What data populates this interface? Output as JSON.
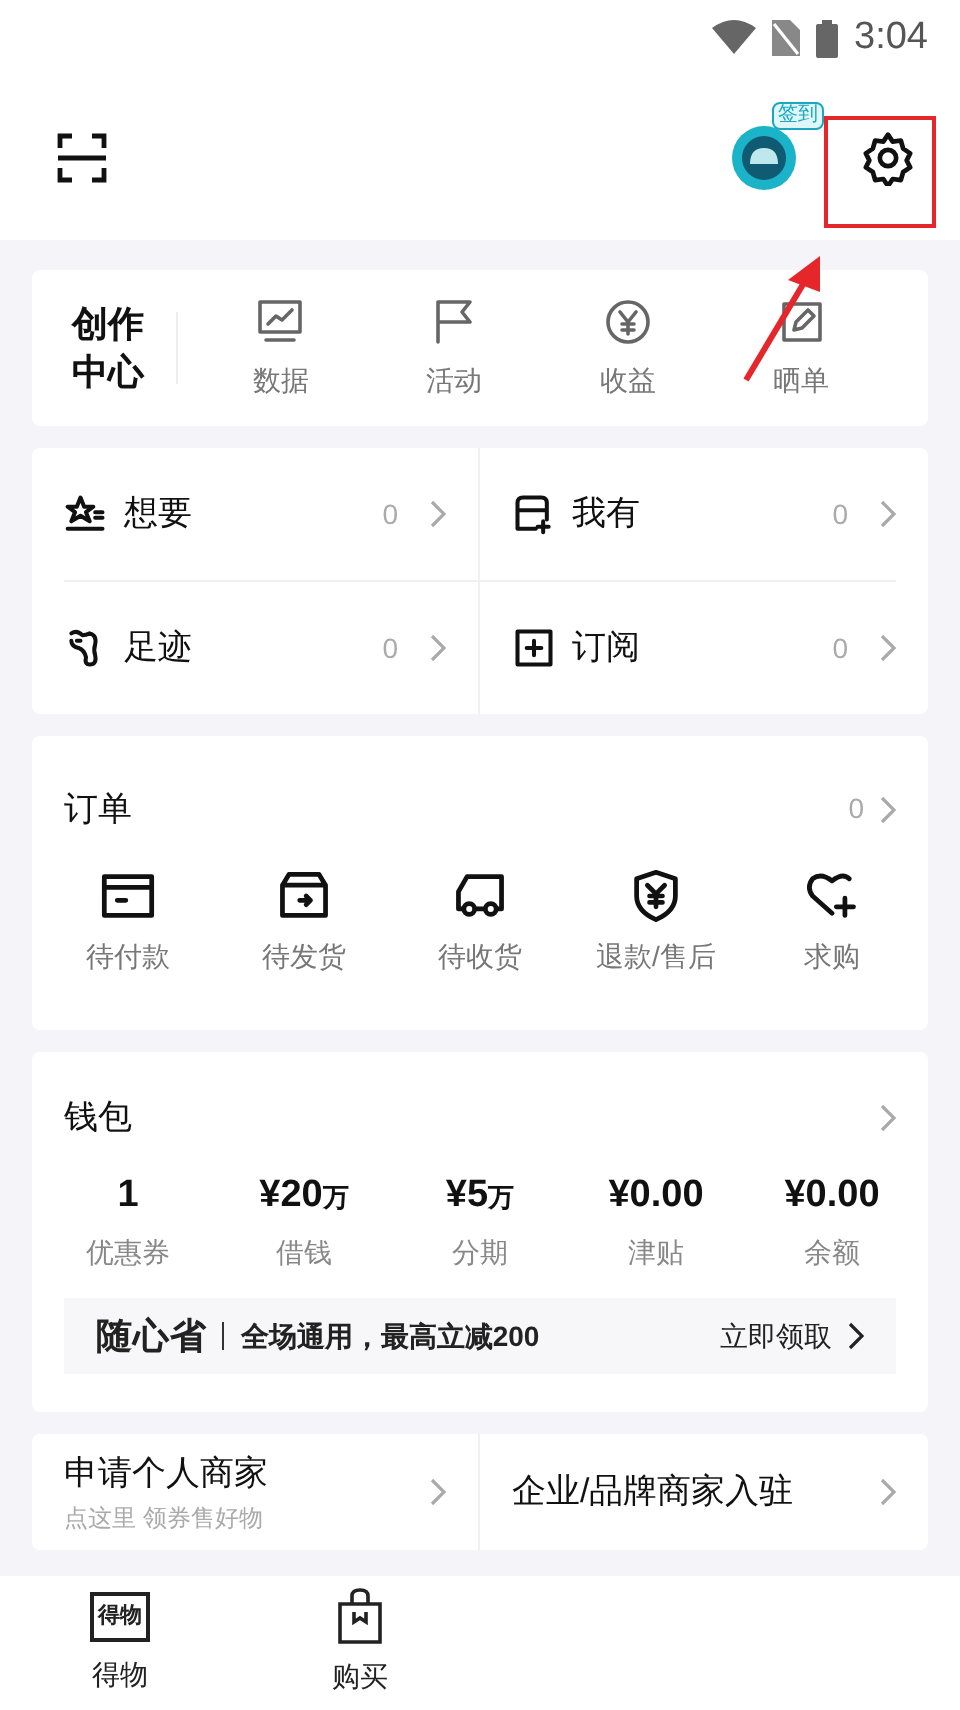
{
  "status_bar": {
    "time": "3:04"
  },
  "header": {
    "checkin_badge": "签到"
  },
  "creator_center": {
    "title": "创作中心",
    "items": [
      {
        "kind": "chart",
        "label": "数据"
      },
      {
        "kind": "flag",
        "label": "活动"
      },
      {
        "kind": "coin",
        "label": "收益"
      },
      {
        "kind": "edit",
        "label": "晒单"
      }
    ]
  },
  "collections": [
    {
      "kind": "wish",
      "label": "想要",
      "count": "0"
    },
    {
      "kind": "own",
      "label": "我有",
      "count": "0"
    },
    {
      "kind": "foot",
      "label": "足迹",
      "count": "0"
    },
    {
      "kind": "sub",
      "label": "订阅",
      "count": "0"
    }
  ],
  "orders": {
    "title": "订单",
    "count": "0",
    "items": [
      {
        "kind": "card",
        "label": "待付款"
      },
      {
        "kind": "box",
        "label": "待发货"
      },
      {
        "kind": "truck",
        "label": "待收货"
      },
      {
        "kind": "shield",
        "label": "退款/售后"
      },
      {
        "kind": "heart",
        "label": "求购"
      }
    ]
  },
  "wallet": {
    "title": "钱包",
    "items": [
      {
        "value": "1",
        "label": "优惠券"
      },
      {
        "value": "¥20",
        "unit": "万",
        "label": "借钱"
      },
      {
        "value": "¥5",
        "unit": "万",
        "label": "分期"
      },
      {
        "value": "¥0.00",
        "label": "津贴"
      },
      {
        "value": "¥0.00",
        "label": "余额"
      }
    ],
    "promo": {
      "brand": "随心省",
      "text": "全场通用，最高立减200",
      "action": "立即领取"
    }
  },
  "merchant": [
    {
      "title": "申请个人商家",
      "subtitle": "点这里 领券售好物"
    },
    {
      "title": "企业/品牌商家入驻"
    }
  ],
  "bottom_nav": [
    {
      "kind": "logo",
      "logo_text": "得物",
      "label": "得物"
    },
    {
      "kind": "bag",
      "label": "购买"
    }
  ]
}
